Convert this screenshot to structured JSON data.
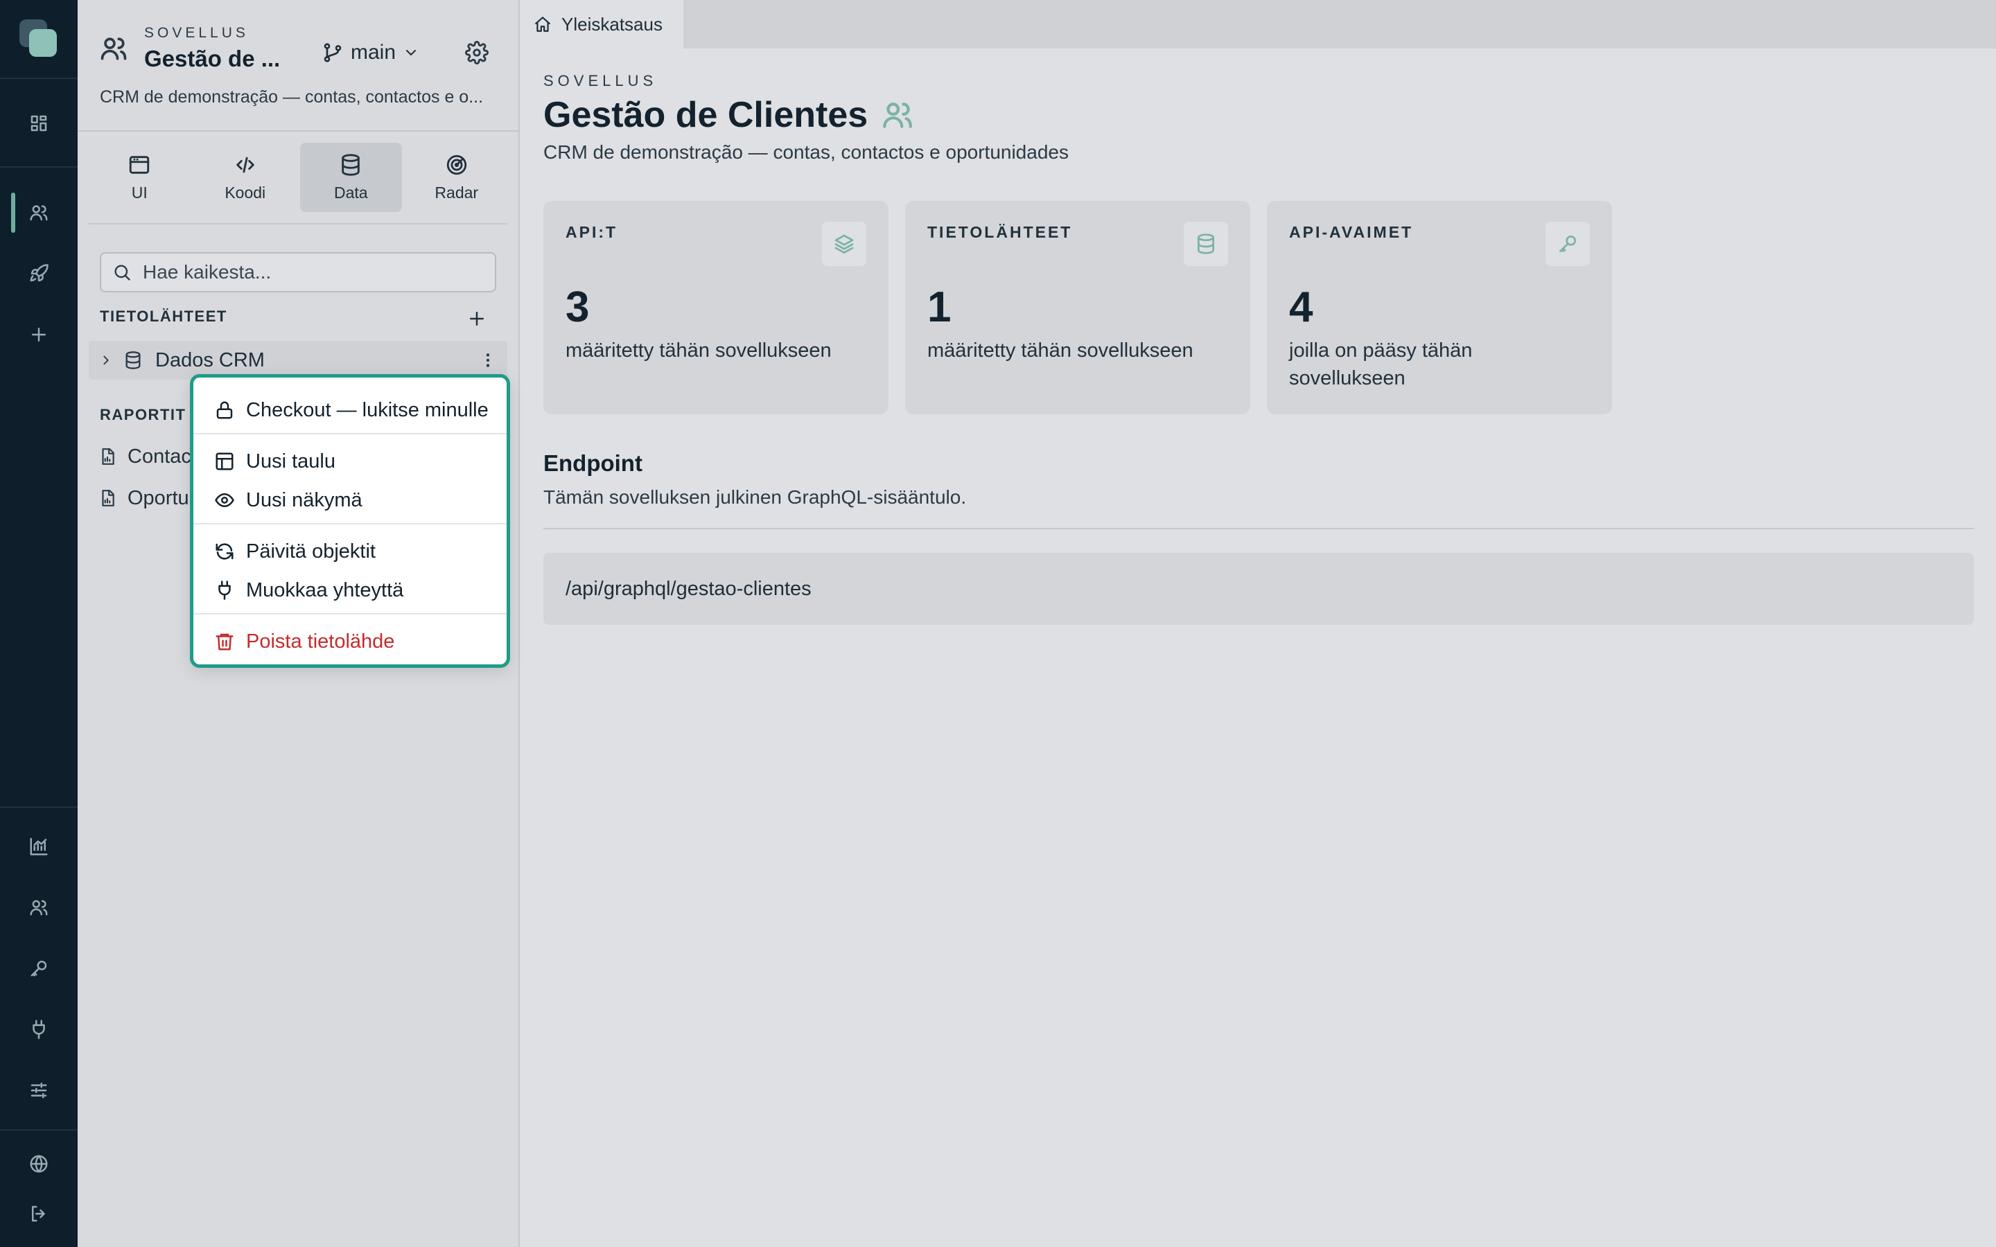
{
  "rail": {
    "top_icons": [
      "grid-icon",
      "users-icon",
      "rocket-icon",
      "plus-icon"
    ],
    "bottom_icons": [
      "analytics-icon",
      "team-icon",
      "key-icon",
      "plug-icon",
      "sliders-icon",
      "globe-icon",
      "logout-icon"
    ]
  },
  "sidebar": {
    "kicker": "SOVELLUS",
    "app_name": "Gestão de ...",
    "branch": "main",
    "description": "CRM de demonstração — contas, contactos e o...",
    "modes": [
      {
        "label": "UI",
        "icon": "window-icon"
      },
      {
        "label": "Koodi",
        "icon": "code-icon"
      },
      {
        "label": "Data",
        "icon": "database-icon",
        "active": true
      },
      {
        "label": "Radar",
        "icon": "radar-icon"
      }
    ],
    "search": {
      "placeholder": "Hae kaikesta..."
    },
    "datasources_label": "TIETOLÄHTEET",
    "datasource": "Dados CRM",
    "reports_label": "RAPORTIT",
    "reports": [
      "Contactos",
      "Oportunidades"
    ]
  },
  "context_menu": {
    "checkout": "Checkout — lukitse minulle",
    "new_table": "Uusi taulu",
    "new_view": "Uusi näkymä",
    "refresh": "Päivitä objektit",
    "edit_connection": "Muokkaa yhteyttä",
    "delete": "Poista tietolähde"
  },
  "main": {
    "tab": "Yleiskatsaus",
    "kicker": "SOVELLUS",
    "title": "Gestão de Clientes",
    "subtitle": "CRM de demonstração — contas, contactos e oportunidades",
    "cards": [
      {
        "label": "API:T",
        "value": "3",
        "caption": "määritetty tähän sovellukseen",
        "icon": "layers-icon"
      },
      {
        "label": "TIETOLÄHTEET",
        "value": "1",
        "caption": "määritetty tähän sovellukseen",
        "icon": "database-icon"
      },
      {
        "label": "API-AVAIMET",
        "value": "4",
        "caption": "joilla on pääsy tähän sovellukseen",
        "icon": "key-icon"
      }
    ],
    "endpoint": {
      "title": "Endpoint",
      "description": "Tämän sovelluksen julkinen GraphQL-sisääntulo.",
      "path": "/api/graphql/gestao-clientes"
    }
  },
  "colors": {
    "rail": "#0e1f2b",
    "accent": "#1f9b8a",
    "accent_soft": "#79b3a5",
    "danger": "#c62b2b"
  }
}
